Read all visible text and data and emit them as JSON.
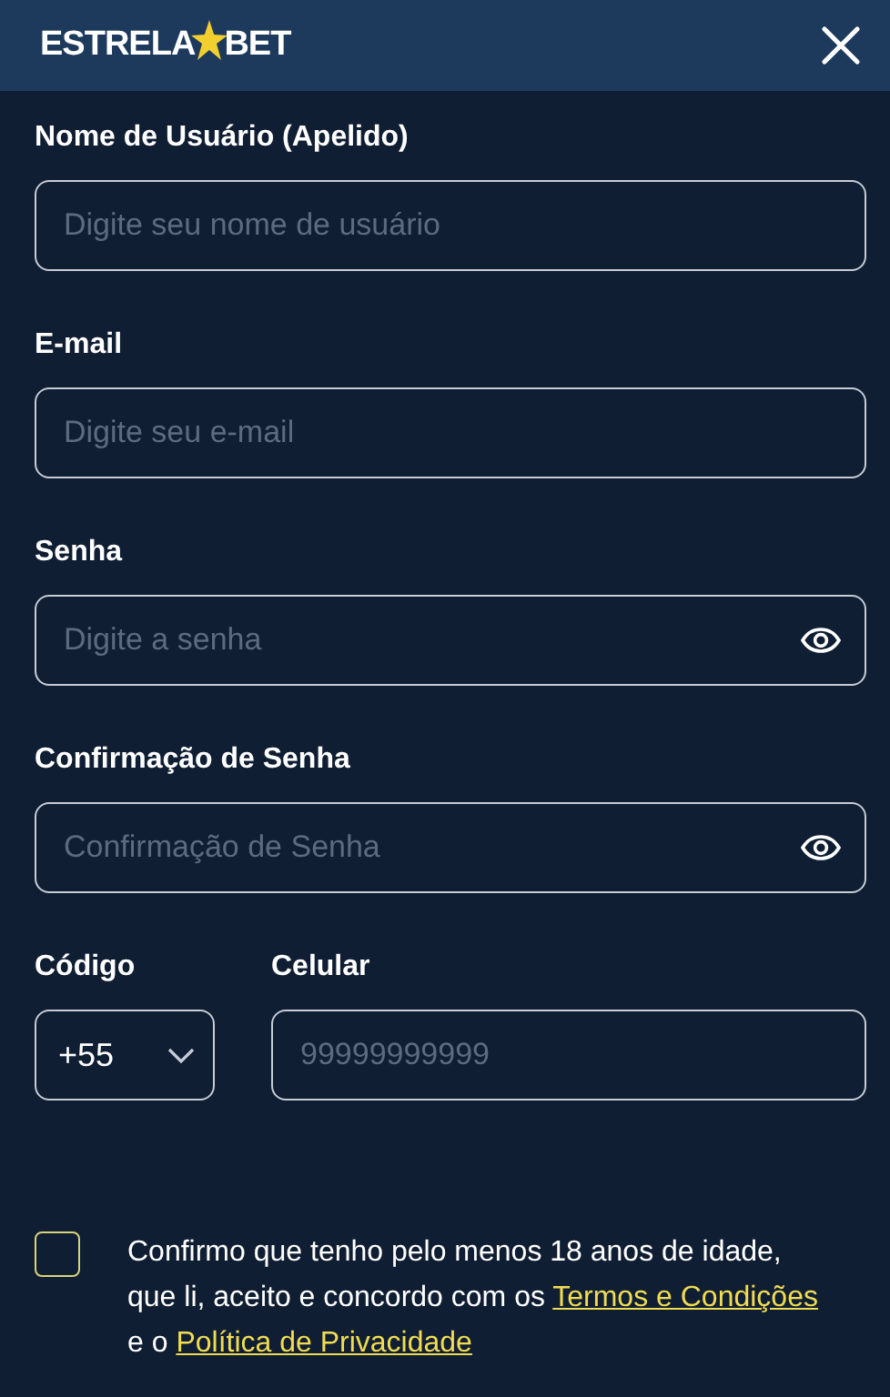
{
  "header": {
    "logo_left": "ESTRELA",
    "logo_right": "BET"
  },
  "fields": [
    {
      "label": "Nome de Usuário (Apelido)",
      "placeholder": "Digite seu nome de usuário",
      "kind": "text"
    },
    {
      "label": "E-mail",
      "placeholder": "Digite seu e-mail",
      "kind": "text"
    },
    {
      "label": "Senha",
      "placeholder": "Digite a senha",
      "kind": "password"
    },
    {
      "label": "Confirmação de Senha",
      "placeholder": "Confirmação de Senha",
      "kind": "password"
    }
  ],
  "phone": {
    "code_label": "Código",
    "code_value": "+55",
    "number_label": "Celular",
    "number_placeholder": "99999999999"
  },
  "consent": {
    "checked": false,
    "parts": [
      {
        "kind": "text",
        "text": "Confirmo que tenho pelo menos 18 anos de idade, que li, aceito e concordo com os "
      },
      {
        "kind": "link",
        "text": "Termos e Condições"
      },
      {
        "kind": "text",
        "text": " e o "
      },
      {
        "kind": "link",
        "text": "Política de Privacidade"
      }
    ]
  }
}
